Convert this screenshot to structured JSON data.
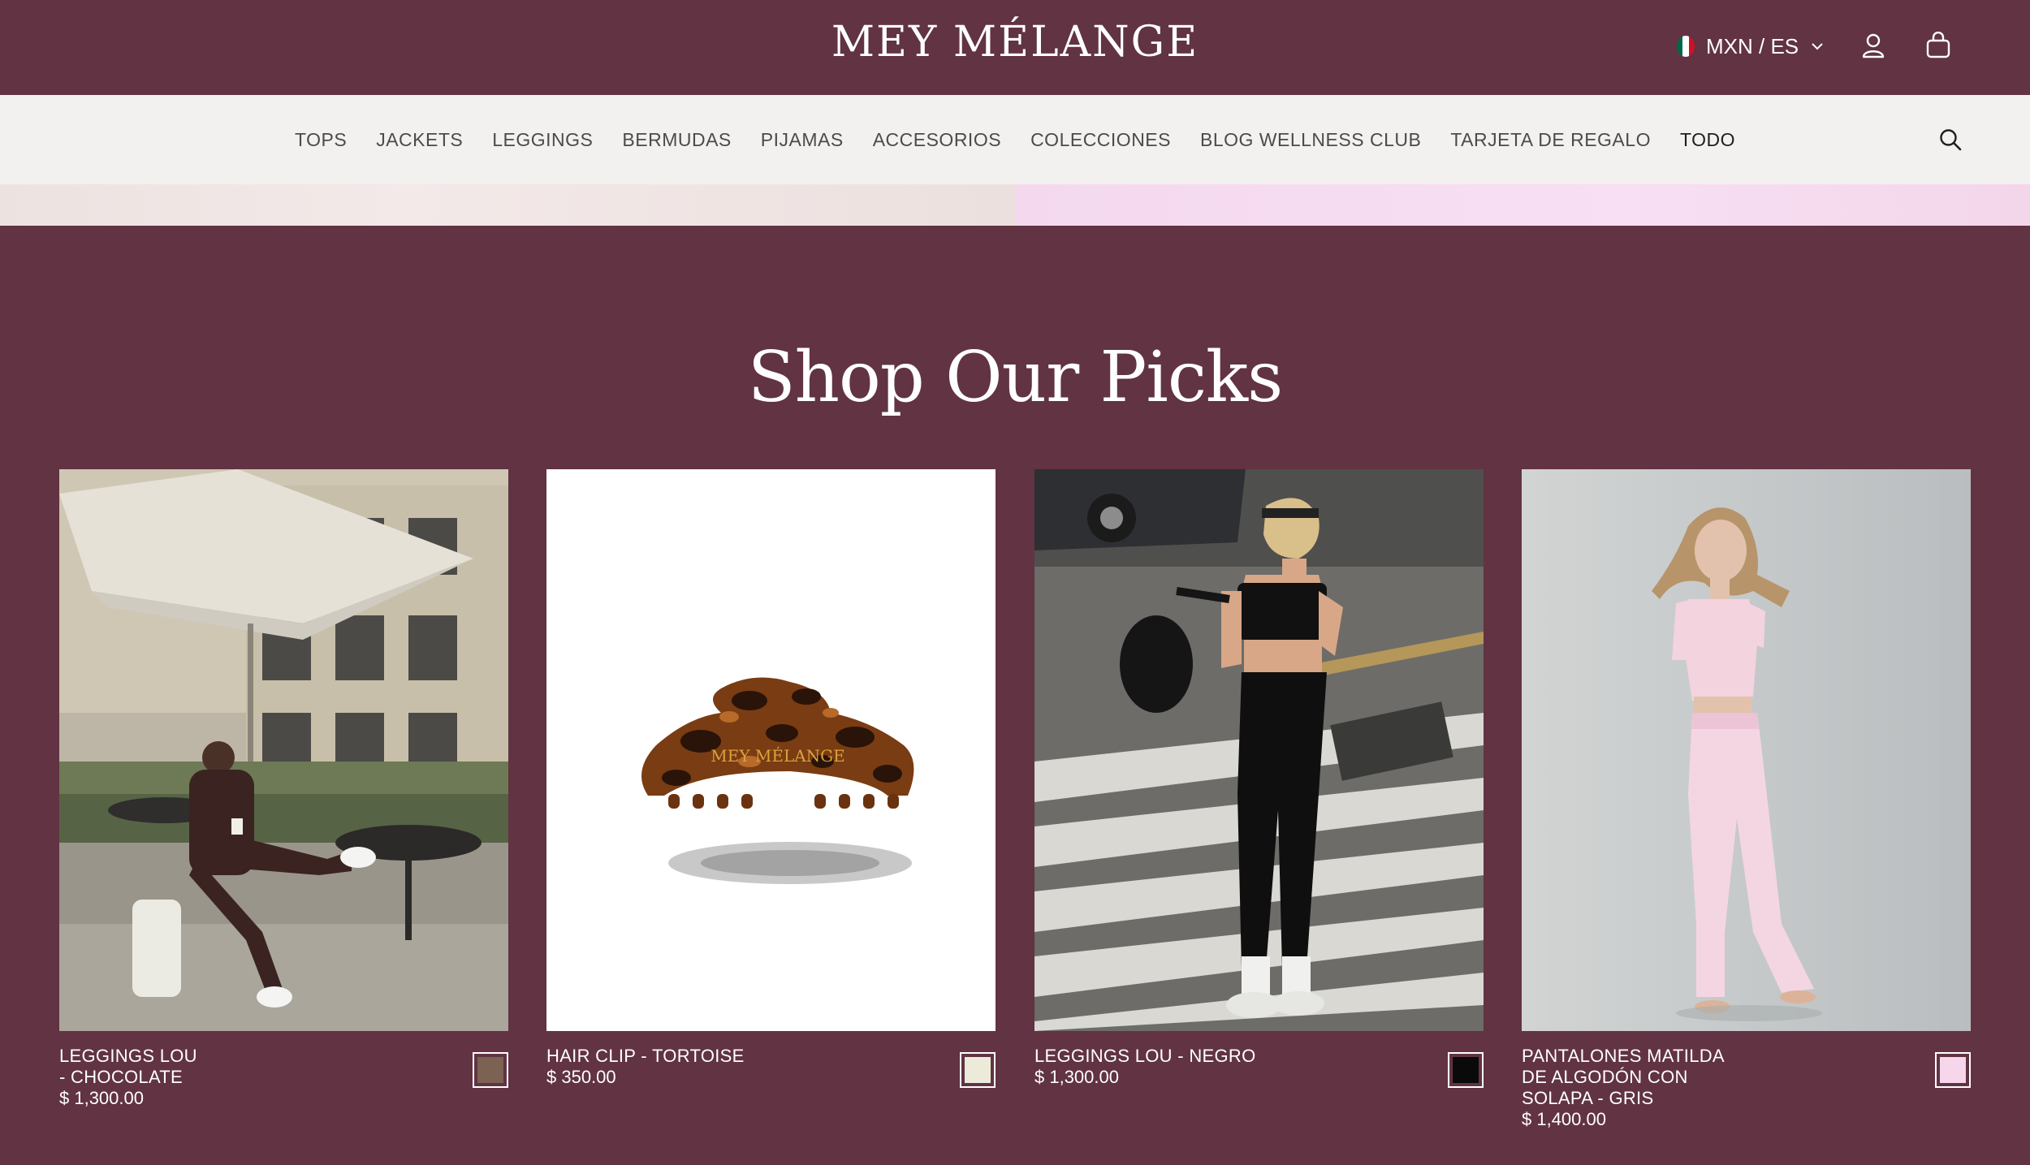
{
  "header": {
    "logo": "MEY MÉLANGE",
    "locale": "MXN / ES",
    "flag_colors": [
      "#006847",
      "#ffffff",
      "#ce1126"
    ]
  },
  "nav": {
    "items": [
      {
        "label": "TOPS"
      },
      {
        "label": "JACKETS"
      },
      {
        "label": "LEGGINGS"
      },
      {
        "label": "BERMUDAS"
      },
      {
        "label": "PIJAMAS"
      },
      {
        "label": "ACCESORIOS"
      },
      {
        "label": "COLECCIONES"
      },
      {
        "label": "BLOG WELLNESS CLUB"
      },
      {
        "label": "TARJETA DE REGALO"
      },
      {
        "label": "TODO"
      }
    ],
    "active": "TODO"
  },
  "section": {
    "title": "Shop Our Picks"
  },
  "products": [
    {
      "name_lines": [
        "LEGGINGS LOU",
        "- CHOCOLATE"
      ],
      "price": "$ 1,300.00",
      "swatch": "#7b6252"
    },
    {
      "name_lines": [
        "HAIR CLIP - TORTOISE"
      ],
      "price": "$ 350.00",
      "swatch": "#ecebd9",
      "clip_logo": "MEY MÉLANGE"
    },
    {
      "name_lines": [
        "LEGGINGS LOU - NEGRO"
      ],
      "price": "$ 1,300.00",
      "swatch": "#0a0a0a"
    },
    {
      "name_lines": [
        "PANTALONES MATILDA",
        "DE ALGODÓN CON",
        "SOLAPA - GRIS"
      ],
      "price": "$ 1,400.00",
      "swatch": "#f5d6ea"
    }
  ],
  "colors": {
    "brand_bg": "#613343",
    "nav_bg": "#f2f1f0"
  }
}
